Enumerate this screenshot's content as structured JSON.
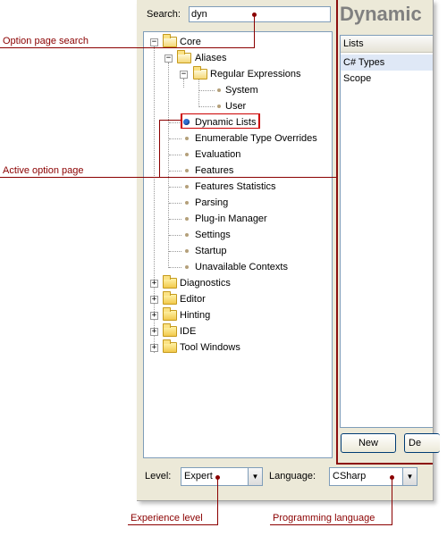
{
  "search": {
    "label": "Search:",
    "value": "dyn"
  },
  "tree": {
    "core": "Core",
    "aliases": "Aliases",
    "regex": "Regular Expressions",
    "system": "System",
    "user": "User",
    "core_items": [
      "Dynamic Lists",
      "Enumerable Type Overrides",
      "Evaluation",
      "Features",
      "Features Statistics",
      "Parsing",
      "Plug-in Manager",
      "Settings",
      "Startup",
      "Unavailable Contexts"
    ],
    "top_folders": [
      "Diagnostics",
      "Editor",
      "Hinting",
      "IDE",
      "Tool Windows"
    ],
    "expander_expanded": "−",
    "expander_collapsed": "+"
  },
  "right_panel": {
    "title": "Dynamic",
    "lists_header": "Lists",
    "lists_items": [
      "C# Types",
      "Scope"
    ],
    "new_button": "New",
    "delete_button": "De"
  },
  "bottom": {
    "level_label": "Level:",
    "level_value": "Expert",
    "language_label": "Language:",
    "language_value": "CSharp",
    "dropdown_glyph": "▼"
  },
  "callouts": {
    "search": "Option page search",
    "active": "Active option page",
    "level": "Experience level",
    "language": "Programming language"
  },
  "colors": {
    "callout": "#8b0000",
    "active_bullet": "#2f6fd0",
    "accent_border": "#8b0e0e"
  }
}
